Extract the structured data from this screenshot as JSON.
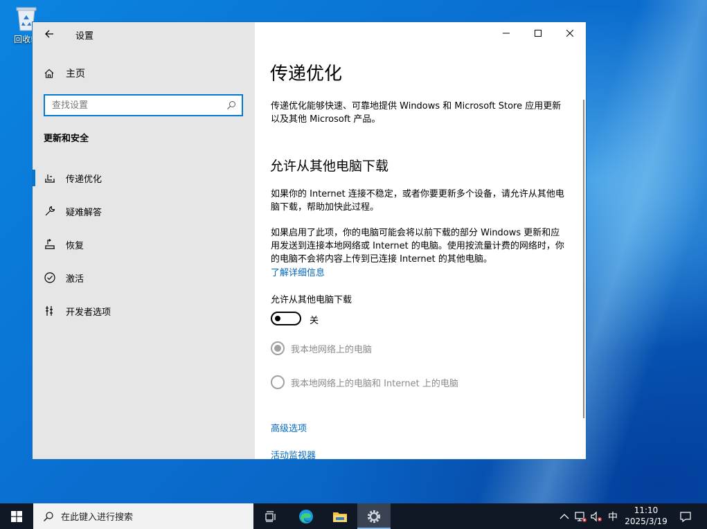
{
  "desktop": {
    "recycle_bin_label": "回收站"
  },
  "window": {
    "app_title": "设置",
    "nav": {
      "home_label": "主页",
      "search_placeholder": "查找设置",
      "section_title": "更新和安全",
      "items": [
        {
          "label": "传递优化",
          "icon": "delivery-optimization-icon",
          "selected": true
        },
        {
          "label": "疑难解答",
          "icon": "wrench-icon",
          "selected": false
        },
        {
          "label": "恢复",
          "icon": "recovery-icon",
          "selected": false
        },
        {
          "label": "激活",
          "icon": "activation-check-icon",
          "selected": false
        },
        {
          "label": "开发者选项",
          "icon": "developer-tools-icon",
          "selected": false
        }
      ]
    },
    "content": {
      "page_title": "传递优化",
      "intro": "传递优化能够快速、可靠地提供 Windows 和 Microsoft Store 应用更新以及其他 Microsoft 产品。",
      "section_heading": "允许从其他电脑下载",
      "para1": "如果你的 Internet 连接不稳定，或者你要更新多个设备，请允许从其他电脑下载，帮助加快此过程。",
      "para2": "如果启用了此项，你的电脑可能会将以前下载的部分 Windows 更新和应用发送到连接本地网络或 Internet 的电脑。使用按流量计费的网络时，你的电脑不会将内容上传到已连接 Internet 的其他电脑。",
      "learn_more_link": "了解详细信息",
      "toggle_label": "允许从其他电脑下载",
      "toggle_state": "关",
      "toggle_on": false,
      "radio1_label": "我本地网络上的电脑",
      "radio2_label": "我本地网络上的电脑和 Internet 上的电脑",
      "advanced_options_link": "高级选项",
      "activity_monitor_link": "活动监视器"
    }
  },
  "taskbar": {
    "search_placeholder": "在此键入进行搜索",
    "apps": [
      "task-view-icon",
      "edge-icon",
      "file-explorer-icon",
      "settings-icon"
    ],
    "ime_indicator": "中",
    "time": "11:10",
    "date": "2025/3/19"
  },
  "colors": {
    "accent": "#0078d4",
    "link": "#0067c0",
    "sidebar_bg": "#e6e6e6",
    "taskbar_bg": "#101826"
  }
}
